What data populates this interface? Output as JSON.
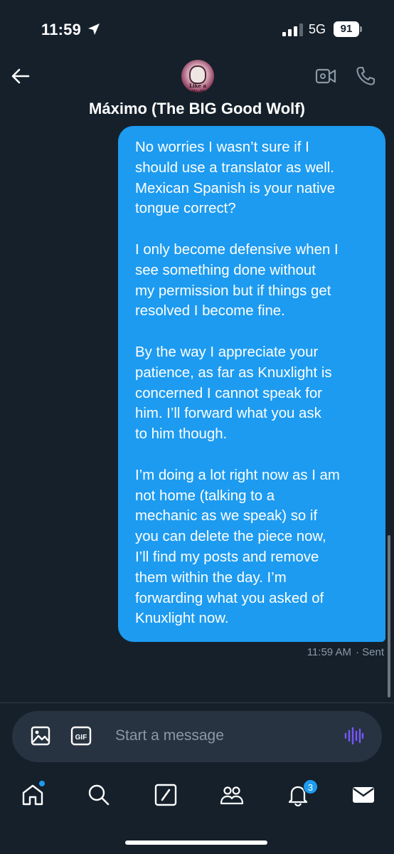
{
  "status_bar": {
    "time": "11:59",
    "network": "5G",
    "battery": "91"
  },
  "header": {
    "contact_name": "Máximo (The BIG Good Wolf)",
    "avatar_text": "Like a Wolf",
    "icons": {
      "back": "arrow-left-icon",
      "video": "video-camera-icon",
      "call": "phone-icon"
    }
  },
  "messages": [
    {
      "direction": "sent",
      "paragraphs": [
        "No worries I wasn’t sure if I\nshould use a translator as well.\nMexican Spanish is your native\ntongue correct?",
        "I only become defensive when I\nsee something done without\nmy permission but if things get\nresolved I become fine.",
        "By the way I appreciate your\npatience, as far as Knuxlight is\nconcerned I cannot speak for\nhim.  I’ll forward what you ask\nto him though.",
        "I’m doing a lot right now as I am\nnot home (talking to a\nmechanic as we speak) so if\nyou can delete the piece now,\nI’ll find my posts and remove\nthem within the day. I’m\nforwarding what you asked of\nKnuxlight now."
      ],
      "time": "11:59 AM",
      "status": "· Sent"
    }
  ],
  "composer": {
    "placeholder": "Start a message",
    "gif_label": "GIF",
    "icons": {
      "media": "image-icon",
      "gif": "gif-icon",
      "voice": "voice-wave-icon"
    }
  },
  "tab_bar": {
    "tabs": [
      {
        "name": "home",
        "icon": "home-icon"
      },
      {
        "name": "search",
        "icon": "search-icon"
      },
      {
        "name": "compose",
        "icon": "compose-icon"
      },
      {
        "name": "communities",
        "icon": "people-icon"
      },
      {
        "name": "notifications",
        "icon": "bell-icon",
        "badge": "3"
      },
      {
        "name": "messages",
        "icon": "envelope-icon"
      }
    ]
  },
  "colors": {
    "background": "#15202b",
    "accent": "#1d9bf0",
    "composer": "#273340",
    "muted": "#8b98a5"
  }
}
